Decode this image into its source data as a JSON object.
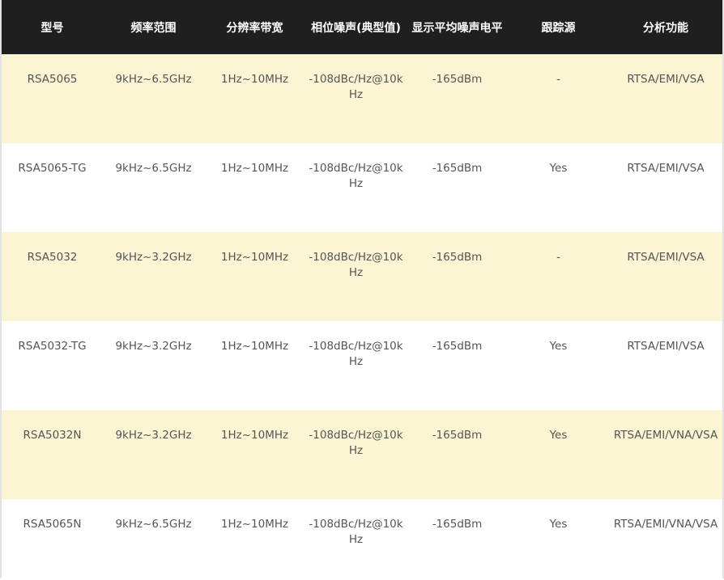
{
  "table": {
    "headers": [
      "型号",
      "频率范围",
      "分辨率带宽",
      "相位噪声(典型值)",
      "显示平均噪声电平",
      "跟踪源",
      "分析功能"
    ],
    "rows": [
      [
        "RSA5065",
        "9kHz~6.5GHz",
        "1Hz~10MHz",
        "-108dBc/Hz@10kHz",
        "-165dBm",
        "-",
        "RTSA/EMI/VSA"
      ],
      [
        "RSA5065-TG",
        "9kHz~6.5GHz",
        "1Hz~10MHz",
        "-108dBc/Hz@10kHz",
        "-165dBm",
        "Yes",
        "RTSA/EMI/VSA"
      ],
      [
        "RSA5032",
        "9kHz~3.2GHz",
        "1Hz~10MHz",
        "-108dBc/Hz@10kHz",
        "-165dBm",
        "-",
        "RTSA/EMI/VSA"
      ],
      [
        "RSA5032-TG",
        "9kHz~3.2GHz",
        "1Hz~10MHz",
        "-108dBc/Hz@10kHz",
        "-165dBm",
        "Yes",
        "RTSA/EMI/VSA"
      ],
      [
        "RSA5032N",
        "9kHz~3.2GHz",
        "1Hz~10MHz",
        "-108dBc/Hz@10kHz",
        "-165dBm",
        "Yes",
        "RTSA/EMI/VNA/VSA"
      ],
      [
        "RSA5065N",
        "9kHz~6.5GHz",
        "1Hz~10MHz",
        "-108dBc/Hz@10kHz",
        "-165dBm",
        "Yes",
        "RTSA/EMI/VNA/VSA"
      ]
    ]
  },
  "colors": {
    "header_bg": "#1f1f1f",
    "header_text": "#ffffff",
    "row_alt_bg": "#fbf5d3",
    "row_bg": "#ffffff",
    "cell_text": "#555555"
  }
}
